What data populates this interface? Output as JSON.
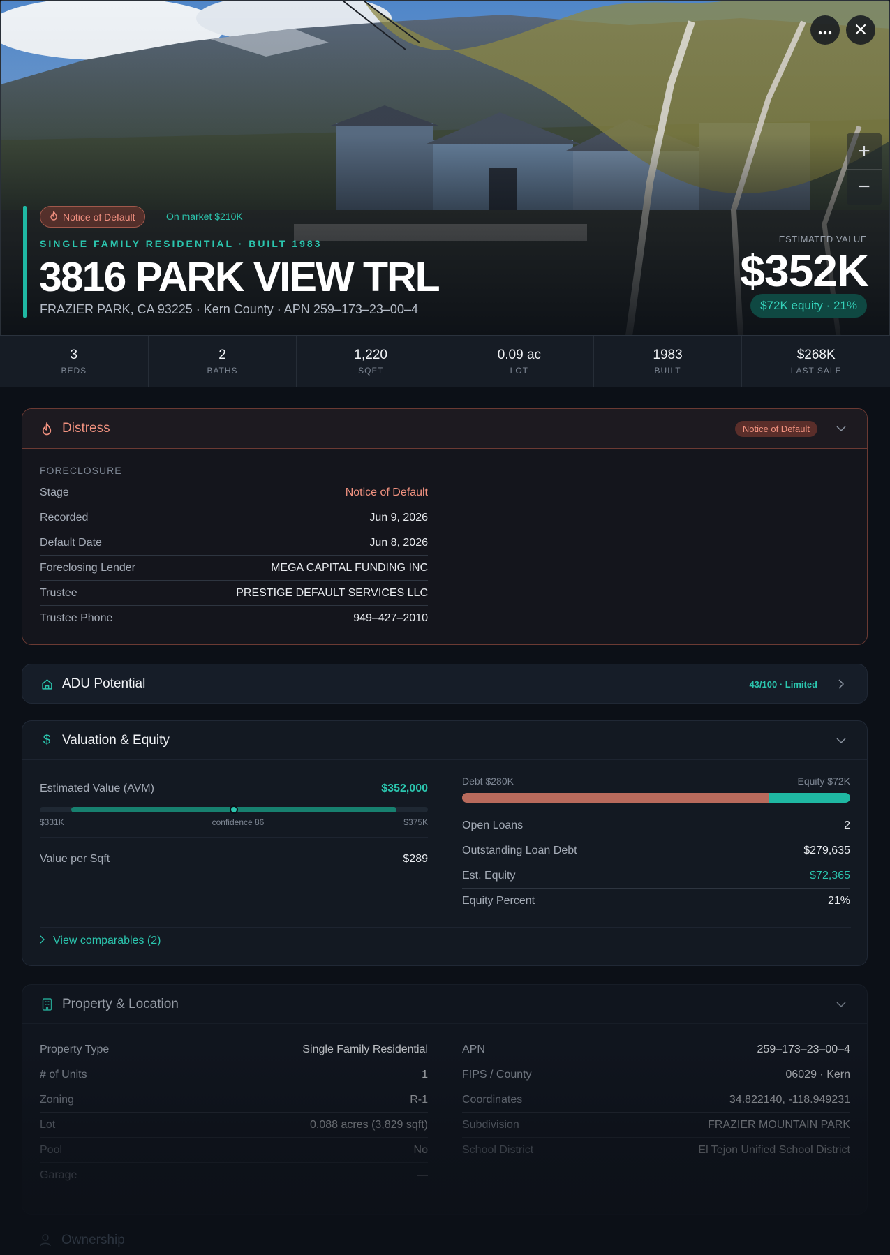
{
  "hero": {
    "status_badge": "Notice of Default",
    "on_market": "On market $210K",
    "subtype": "SINGLE FAMILY RESIDENTIAL · BUILT 1983",
    "address": "3816 PARK VIEW TRL",
    "address_sub": "FRAZIER PARK, CA 93225 · Kern County · APN 259–173–23–00–4",
    "est_label": "ESTIMATED VALUE",
    "est_value": "$352K",
    "equity_pill": "$72K equity · 21%",
    "more_icon": "more-horizontal-icon",
    "close_icon": "close-icon"
  },
  "stats": [
    {
      "value": "3",
      "label": "BEDS"
    },
    {
      "value": "2",
      "label": "BATHS"
    },
    {
      "value": "1,220",
      "label": "SQFT"
    },
    {
      "value": "0.09 ac",
      "label": "LOT"
    },
    {
      "value": "1983",
      "label": "BUILT"
    },
    {
      "value": "$268K",
      "label": "LAST SALE"
    }
  ],
  "distress": {
    "title": "Distress",
    "badge": "Notice of Default",
    "section": "FORECLOSURE",
    "rows": [
      {
        "k": "Stage",
        "v": "Notice of Default"
      },
      {
        "k": "Recorded",
        "v": "Jun 9, 2026"
      },
      {
        "k": "Default Date",
        "v": "Jun 8, 2026"
      },
      {
        "k": "Foreclosing Lender",
        "v": "MEGA CAPITAL FUNDING INC"
      },
      {
        "k": "Trustee",
        "v": "PRESTIGE DEFAULT SERVICES LLC"
      },
      {
        "k": "Trustee Phone",
        "v": "949–427–2010"
      }
    ]
  },
  "adu": {
    "title": "ADU Potential",
    "score": "43/100 · Limited"
  },
  "valuation": {
    "title": "Valuation & Equity",
    "avm_label": "Estimated Value (AVM)",
    "avm_value": "$352,000",
    "range_low": "$331K",
    "range_high": "$375K",
    "confidence": "confidence 86",
    "confidence_position": 0.5,
    "value_per_sqft_label": "Value per Sqft",
    "value_per_sqft": "$289",
    "debt_label": "Debt $280K",
    "equity_label": "Equity $72K",
    "debt_fraction": 0.79,
    "rows": [
      {
        "k": "Open Loans",
        "v": "2"
      },
      {
        "k": "Outstanding Loan Debt",
        "v": "$279,635"
      },
      {
        "k": "Est. Equity",
        "v": "$72,365"
      },
      {
        "k": "Equity Percent",
        "v": "21%"
      }
    ],
    "view_comparables": "View comparables (2)"
  },
  "property": {
    "title": "Property & Location",
    "left": [
      {
        "k": "Property Type",
        "v": "Single Family Residential"
      },
      {
        "k": "# of Units",
        "v": "1"
      },
      {
        "k": "Zoning",
        "v": "R-1"
      },
      {
        "k": "Lot",
        "v": "0.088 acres (3,829 sqft)"
      },
      {
        "k": "Pool",
        "v": "No"
      },
      {
        "k": "Garage",
        "v": "—"
      }
    ],
    "right": [
      {
        "k": "APN",
        "v": "259–173–23–00–4"
      },
      {
        "k": "FIPS / County",
        "v": "06029 · Kern"
      },
      {
        "k": "Coordinates",
        "v": "34.822140, -118.949231"
      },
      {
        "k": "Subdivision",
        "v": "FRAZIER MOUNTAIN PARK"
      },
      {
        "k": "School District",
        "v": "El Tejon Unified School District"
      }
    ]
  },
  "ownership": {
    "title": "Ownership"
  },
  "colors": {
    "accent": "#1fb8a3",
    "distress": "#f0917f",
    "debt": "#b86a5c"
  }
}
